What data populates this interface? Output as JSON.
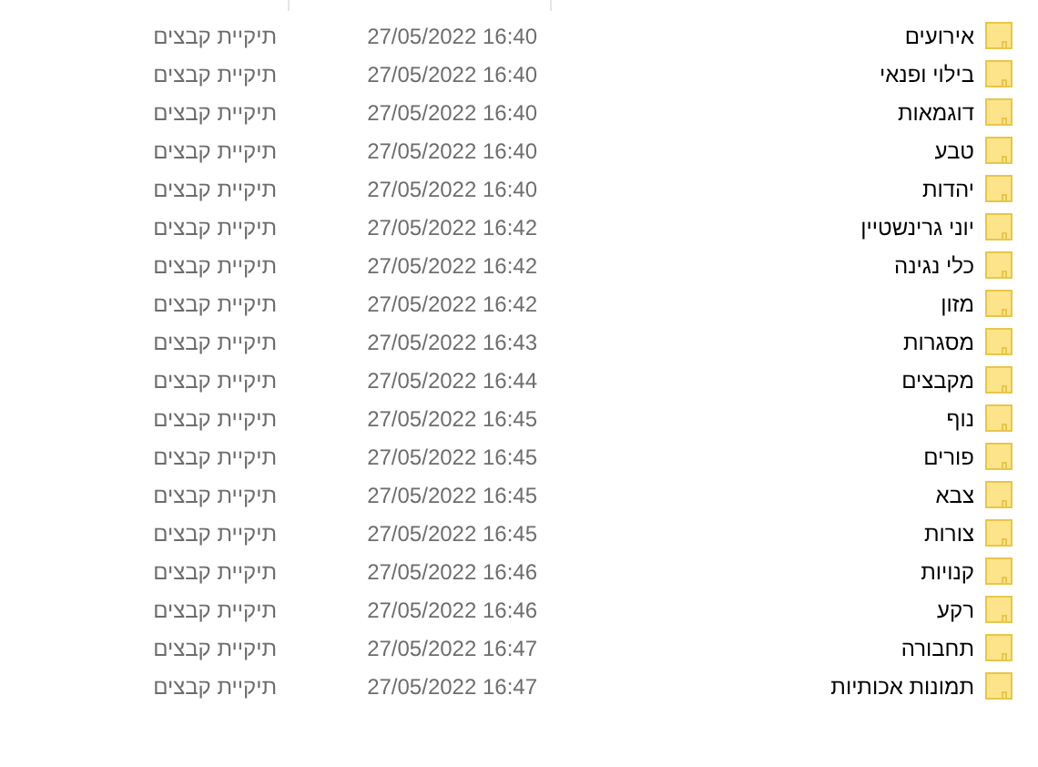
{
  "rows": [
    {
      "name": "אירועים",
      "modified": "27/05/2022 16:40",
      "type": "תיקיית קבצים"
    },
    {
      "name": "בילוי ופנאי",
      "modified": "27/05/2022 16:40",
      "type": "תיקיית קבצים"
    },
    {
      "name": "דוגמאות",
      "modified": "27/05/2022 16:40",
      "type": "תיקיית קבצים"
    },
    {
      "name": "טבע",
      "modified": "27/05/2022 16:40",
      "type": "תיקיית קבצים"
    },
    {
      "name": "יהדות",
      "modified": "27/05/2022 16:40",
      "type": "תיקיית קבצים"
    },
    {
      "name": "יוני גרינשטיין",
      "modified": "27/05/2022 16:42",
      "type": "תיקיית קבצים"
    },
    {
      "name": "כלי נגינה",
      "modified": "27/05/2022 16:42",
      "type": "תיקיית קבצים"
    },
    {
      "name": "מזון",
      "modified": "27/05/2022 16:42",
      "type": "תיקיית קבצים"
    },
    {
      "name": "מסגרות",
      "modified": "27/05/2022 16:43",
      "type": "תיקיית קבצים"
    },
    {
      "name": "מקבצים",
      "modified": "27/05/2022 16:44",
      "type": "תיקיית קבצים"
    },
    {
      "name": "נוף",
      "modified": "27/05/2022 16:45",
      "type": "תיקיית קבצים"
    },
    {
      "name": "פורים",
      "modified": "27/05/2022 16:45",
      "type": "תיקיית קבצים"
    },
    {
      "name": "צבא",
      "modified": "27/05/2022 16:45",
      "type": "תיקיית קבצים"
    },
    {
      "name": "צורות",
      "modified": "27/05/2022 16:45",
      "type": "תיקיית קבצים"
    },
    {
      "name": "קנויות",
      "modified": "27/05/2022 16:46",
      "type": "תיקיית קבצים"
    },
    {
      "name": "רקע",
      "modified": "27/05/2022 16:46",
      "type": "תיקיית קבצים"
    },
    {
      "name": "תחבורה",
      "modified": "27/05/2022 16:47",
      "type": "תיקיית קבצים"
    },
    {
      "name": "תמונות אכותיות",
      "modified": "27/05/2022 16:47",
      "type": "תיקיית קבצים"
    }
  ]
}
